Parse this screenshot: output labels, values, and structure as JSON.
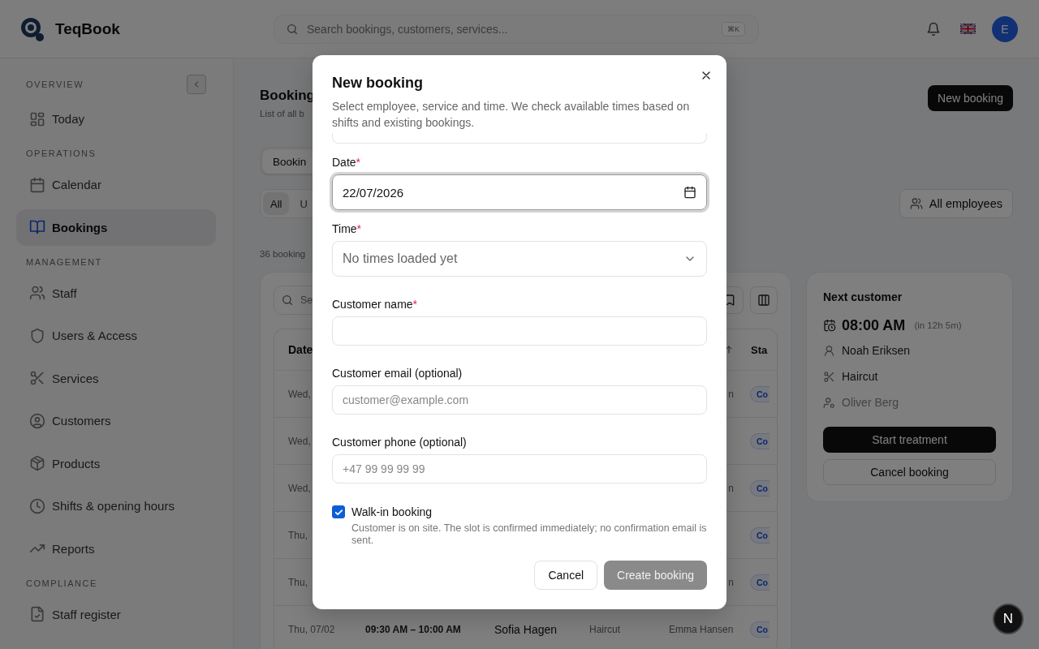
{
  "app": {
    "name": "TeqBook"
  },
  "search": {
    "placeholder": "Search bookings, customers, services...",
    "shortcut": "⌘K"
  },
  "user": {
    "initial": "E"
  },
  "sidebar": {
    "sections": [
      {
        "title": "OVERVIEW",
        "items": [
          {
            "label": "Today",
            "selected": false
          }
        ]
      },
      {
        "title": "OPERATIONS",
        "items": [
          {
            "label": "Calendar",
            "selected": false
          },
          {
            "label": "Bookings",
            "selected": true
          }
        ]
      },
      {
        "title": "MANAGEMENT",
        "items": [
          {
            "label": "Staff",
            "selected": false
          },
          {
            "label": "Users & Access",
            "selected": false
          },
          {
            "label": "Services",
            "selected": false
          },
          {
            "label": "Customers",
            "selected": false
          },
          {
            "label": "Products",
            "selected": false
          },
          {
            "label": "Shifts & opening hours",
            "selected": false
          },
          {
            "label": "Reports",
            "selected": false
          }
        ]
      },
      {
        "title": "COMPLIANCE",
        "items": [
          {
            "label": "Staff register",
            "selected": false
          }
        ]
      }
    ]
  },
  "page": {
    "title": "Booking",
    "subtitle": "List of all b",
    "new_button": "New booking",
    "tabs": [
      {
        "label": "Bookin",
        "selected": true
      }
    ],
    "filters": [
      {
        "label": "All",
        "selected": true
      },
      {
        "label": "U",
        "selected": false
      }
    ],
    "employee_filter": "All employees",
    "count": "36 booking"
  },
  "table": {
    "search_placeholder": "Se",
    "columns": [
      {
        "label": "Date"
      },
      {
        "label": "Sta"
      }
    ],
    "rows": [
      {
        "kind": "cut",
        "date": "Wed,",
        "employee": "n",
        "status": "Co"
      },
      {
        "kind": "cut",
        "date": "Wed,",
        "status": "Co"
      },
      {
        "kind": "cut",
        "date": "Wed,",
        "employee": "n",
        "status": "Co"
      },
      {
        "kind": "cut",
        "date": "Thu,",
        "status": "Co"
      },
      {
        "kind": "cut",
        "date": "Thu,",
        "employee": "n",
        "status": "Co"
      },
      {
        "kind": "full",
        "date": "Thu, 07/02",
        "time": "09:30 AM – 10:00 AM",
        "customer": "Sofia Hagen",
        "service": "Haircut",
        "employee": "Emma Hansen",
        "status": "Co"
      }
    ]
  },
  "next_customer": {
    "title": "Next customer",
    "time": "08:00 AM",
    "relative": "(in 12h 5m)",
    "customer": "Noah Eriksen",
    "service": "Haircut",
    "employee": "Oliver Berg",
    "buttons": [
      {
        "label": "Start treatment",
        "kind": "primary"
      },
      {
        "label": "Cancel booking",
        "kind": "secondary"
      }
    ]
  },
  "dialog": {
    "title": "New booking",
    "description": "Select employee, service and time. We check available times based on shifts and existing bookings.",
    "required_mark": "*",
    "fields": [
      {
        "kind": "date",
        "label": "Date",
        "required": true,
        "value": "22/07/2026",
        "focused": true
      },
      {
        "kind": "select",
        "label": "Time",
        "required": true,
        "placeholder": "No times loaded yet",
        "focused": false
      },
      {
        "kind": "text",
        "label": "Customer name",
        "required": true,
        "focused": false
      },
      {
        "kind": "text",
        "label": "Customer email (optional)",
        "required": false,
        "placeholder": "customer@example.com",
        "focused": false
      },
      {
        "kind": "text",
        "label": "Customer phone (optional)",
        "required": false,
        "placeholder": "+47 99 99 99 99",
        "focused": false
      }
    ],
    "walk_in": {
      "label": "Walk-in booking",
      "checked": true,
      "hint": "Customer is on site. The slot is confirmed immediately; no confirmation email is sent."
    },
    "buttons": [
      {
        "label": "Cancel",
        "kind": "secondary",
        "disabled": false
      },
      {
        "label": "Create booking",
        "kind": "primary",
        "disabled": true
      }
    ]
  },
  "dev_badge": "N"
}
